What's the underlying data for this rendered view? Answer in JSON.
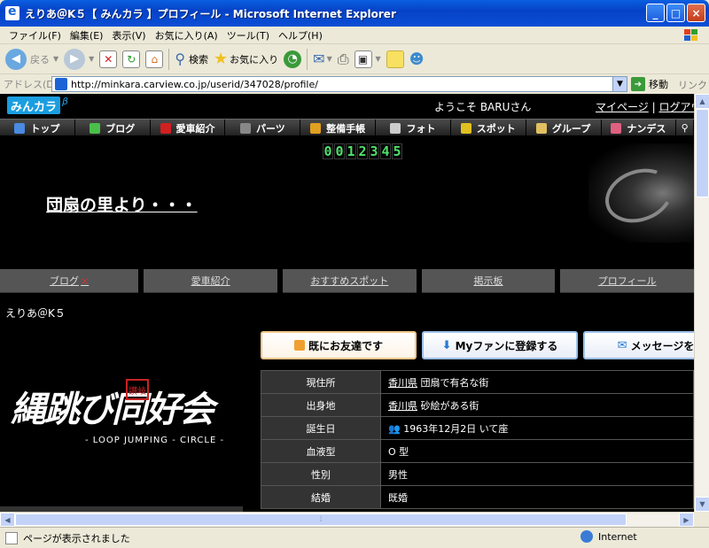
{
  "window": {
    "title": "えりあ＠K５【 みんカラ 】プロフィール - Microsoft Internet Explorer"
  },
  "menu": [
    "ファイル(F)",
    "編集(E)",
    "表示(V)",
    "お気に入り(A)",
    "ツール(T)",
    "ヘルプ(H)"
  ],
  "toolbar": {
    "back": "戻る",
    "search": "検索",
    "favorites": "お気に入り"
  },
  "address": {
    "label": "アドレス(D)",
    "url": "http://minkara.carview.co.jp/userid/347028/profile/",
    "go": "移動",
    "links": "リンク"
  },
  "site": {
    "logo": "みんカラ",
    "beta": "β",
    "welcome": "ようこそ BARUさん",
    "mypage": "マイページ",
    "logout": "ログアウ",
    "nav": [
      {
        "label": "トップ",
        "color": "#4a8ae0"
      },
      {
        "label": "ブログ",
        "color": "#4ac04a"
      },
      {
        "label": "愛車紹介",
        "color": "#d02020"
      },
      {
        "label": "パーツ",
        "color": "#888888"
      },
      {
        "label": "整備手帳",
        "color": "#e0a020"
      },
      {
        "label": "フォト",
        "color": "#cccccc"
      },
      {
        "label": "スポット",
        "color": "#e0c020"
      },
      {
        "label": "グループ",
        "color": "#e0c060"
      },
      {
        "label": "ナンデス",
        "color": "#e06080"
      }
    ],
    "counter": [
      "0",
      "0",
      "1",
      "2",
      "3",
      "4",
      "5"
    ],
    "hero_title": "団扇の里より・・・",
    "subnav": [
      "ブログ",
      "愛車紹介",
      "おすすめスポット",
      "掲示板",
      "プロフィール"
    ],
    "subnav_mark": "×",
    "username": "えりあ＠K５",
    "buttons": {
      "friend": "既にお友達です",
      "fan": "Myファンに登録する",
      "message": "メッセージを送"
    },
    "logo_text": {
      "main": "縄跳び同好会",
      "stamp": "讃岐",
      "sub": "- LOOP JUMPING - CIRCLE -"
    },
    "profile": [
      {
        "key": "現住所",
        "link": "香川県",
        "value": " 団扇で有名な街"
      },
      {
        "key": "出身地",
        "link": "香川県",
        "value": " 砂絵がある街"
      },
      {
        "key": "誕生日",
        "link": "",
        "value": "1963年12月2日 いて座"
      },
      {
        "key": "血液型",
        "link": "",
        "value": "O 型"
      },
      {
        "key": "性別",
        "link": "",
        "value": "男性"
      },
      {
        "key": "結婚",
        "link": "",
        "value": "既婚"
      }
    ]
  },
  "status": {
    "text": "ページが表示されました",
    "zone": "Internet"
  }
}
